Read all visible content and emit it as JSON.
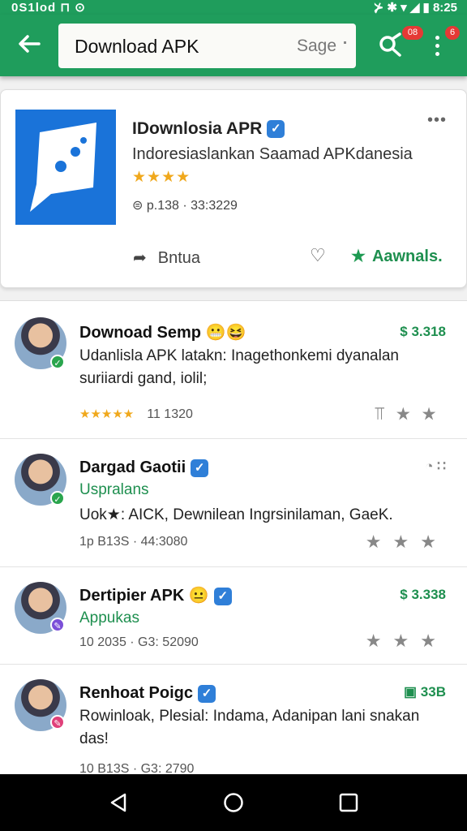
{
  "status": {
    "left": "0S1lod  ⊓ ⊙",
    "right": "⊁ ✱ ▾ ◢ ▮  8:25"
  },
  "appbar": {
    "search_query": "Download APK",
    "search_hint": "Sage",
    "badge1": "08",
    "badge2": "6"
  },
  "card": {
    "title": "IDownlosia APR",
    "subtitle": "Indoresiaslankan Saamad APKdanesia",
    "rating_stars": "★★★★",
    "meta": "⊜ p.138  · 33:3229",
    "more": "•••",
    "share_label": "Bntua",
    "install_label": "Aawnals."
  },
  "rows": [
    {
      "name": "Downoad Semp",
      "name_emoji": "😬😆",
      "right": "$ 3.318",
      "text": "Udanlisla APK latakn: Inagethonkemi dyanalan suriiardi gand, iolil;",
      "stars": "★★★★★",
      "meta": "11 1320"
    },
    {
      "name": "Dargad Gaotii",
      "right": "◔  ∷",
      "subtitle": "Uspralans",
      "text": "Uok★: AICK, Dewnilean Ingrsinilaman, GaeK.",
      "meta": "1p B13S · 44:3080"
    },
    {
      "name": "Dertipier APK",
      "name_emoji": "😐",
      "right": "$ 3.338",
      "subtitle": "Appukas",
      "meta": "10 2035 · G3: 52090"
    },
    {
      "name": "Renhoat Poigc",
      "right": "▣  33B",
      "text": "Rowinloak, Plesial: Indama, Adanipan lani snakan das!",
      "meta": "10 B13S · G3: 2790"
    }
  ],
  "colors": {
    "brand_green": "#1f9d5c",
    "accent_blue": "#2f7fd8",
    "star_orange": "#f0a81c"
  }
}
